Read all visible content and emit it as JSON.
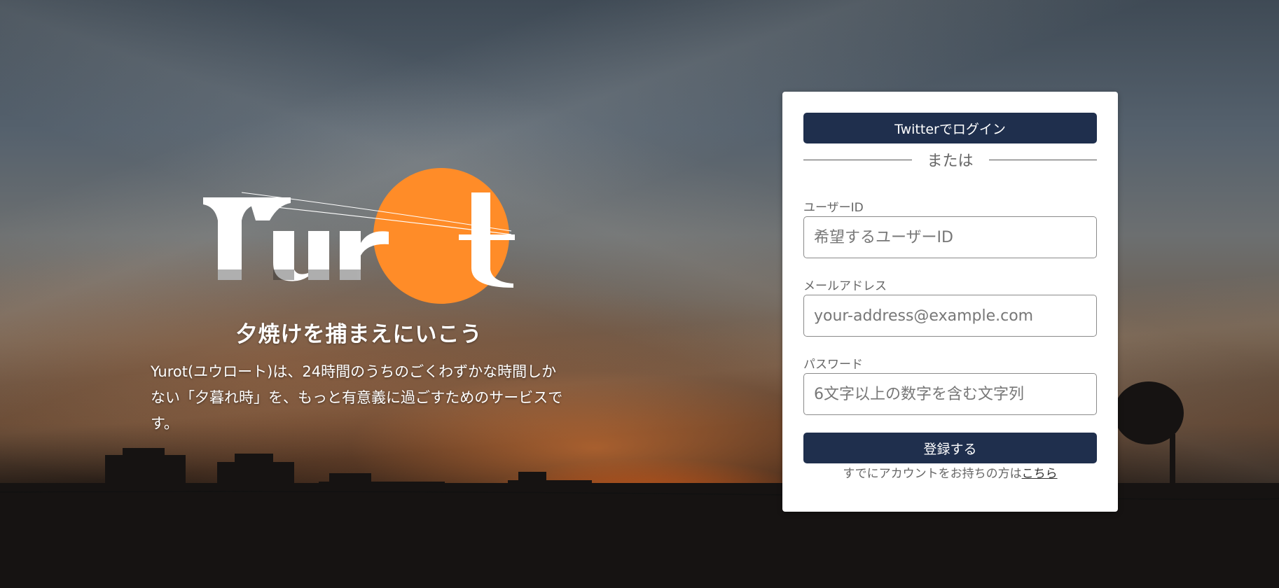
{
  "hero": {
    "logo_text": "Yurt",
    "tagline": "夕焼けを捕まえにいこう",
    "description": "Yurot(ユウロート)は、24時間のうちのごくわずかな時間しかない「夕暮れ時」を、もっと有意義に過ごすためのサービスです。"
  },
  "signup": {
    "twitter_button": "Twitterでログイン",
    "divider_text": "または",
    "user_id": {
      "label": "ユーザーID",
      "placeholder": "希望するユーザーID",
      "value": ""
    },
    "email": {
      "label": "メールアドレス",
      "placeholder": "your-address@example.com",
      "value": ""
    },
    "password": {
      "label": "パスワード",
      "placeholder": "6文字以上の数字を含む文字列",
      "value": ""
    },
    "submit_button": "登録する",
    "signin_prompt": "すでにアカウントをお持ちの方は",
    "signin_link": "こちら"
  },
  "colors": {
    "button": "#1f2f4d",
    "sun": "#ff8c28"
  }
}
